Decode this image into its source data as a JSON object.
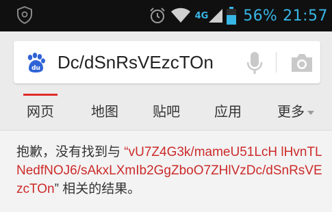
{
  "status_bar": {
    "network_type": "4G",
    "battery_percent": "56%",
    "time": "21:57",
    "icons": [
      "shield-icon",
      "alarm-icon",
      "wifi-icon",
      "signal-icon",
      "battery-icon"
    ],
    "accent_color": "#38b6e6"
  },
  "search": {
    "logo": "baidu-paw-icon",
    "query": "Dc/dSnRsVEzcTOn",
    "mic_icon": "microphone-icon",
    "camera_icon": "camera-icon"
  },
  "tabs": [
    {
      "label": "网页",
      "active": true
    },
    {
      "label": "地图",
      "active": false
    },
    {
      "label": "贴吧",
      "active": false
    },
    {
      "label": "应用",
      "active": false
    },
    {
      "label": "更多",
      "active": false
    }
  ],
  "result": {
    "prefix": "抱歉，没有找到与",
    "open_quote": "“",
    "query_full": "vU7Z4G3k/mameU51LcH lHvnTLNedfNOJ6/sAkxLXmIb2GgZboO7ZHlVzDc/dSnRsVEzcTOn",
    "close_quote": "”",
    "suffix": "相关的结果。"
  }
}
